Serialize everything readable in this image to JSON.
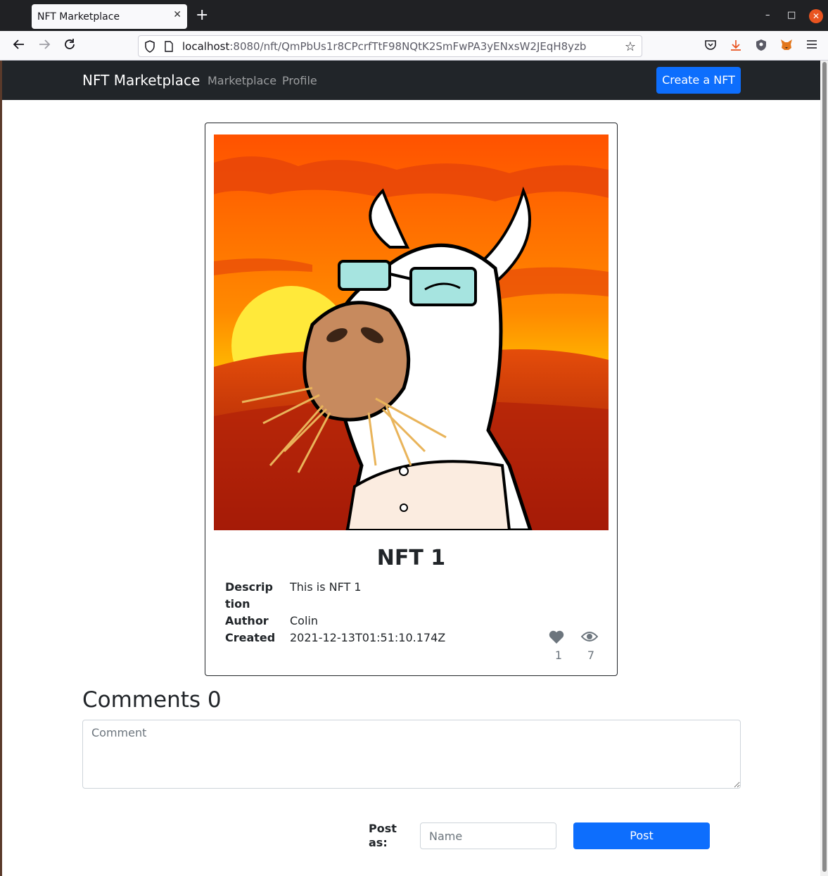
{
  "browser": {
    "tab_title": "NFT Marketplace",
    "tab_close": "✕",
    "new_tab": "+",
    "url_host": "localhost",
    "url_rest": ":8080/nft/QmPbUs1r8CPcrfTtF98NQtK2SmFwPA3yENxsW2JEqH8yzb",
    "window_controls": {
      "minimize": "–",
      "maximize": "□",
      "close": "✕"
    }
  },
  "navbar": {
    "brand": "NFT Marketplace",
    "links": [
      "Marketplace",
      "Profile"
    ],
    "create_button": "Create a NFT"
  },
  "nft": {
    "title": "NFT 1",
    "image_subject": "cartoon llama with sunglasses against sunset",
    "fields": [
      {
        "label": "Description",
        "value": "This is NFT 1"
      },
      {
        "label": "Author",
        "value": "Colin"
      },
      {
        "label": "Created",
        "value": "2021-12-13T01:51:10.174Z"
      }
    ],
    "likes": "1",
    "views": "7"
  },
  "comments": {
    "heading": "Comments 0",
    "placeholder": "Comment",
    "post_as_label": "Post as:",
    "name_placeholder": "Name",
    "post_button": "Post"
  },
  "colors": {
    "primary": "#0d6efd",
    "navbar_bg": "#212529",
    "sky_top": "#ff5a00",
    "sky_bottom": "#ffb000",
    "sun": "#ffe93a"
  }
}
